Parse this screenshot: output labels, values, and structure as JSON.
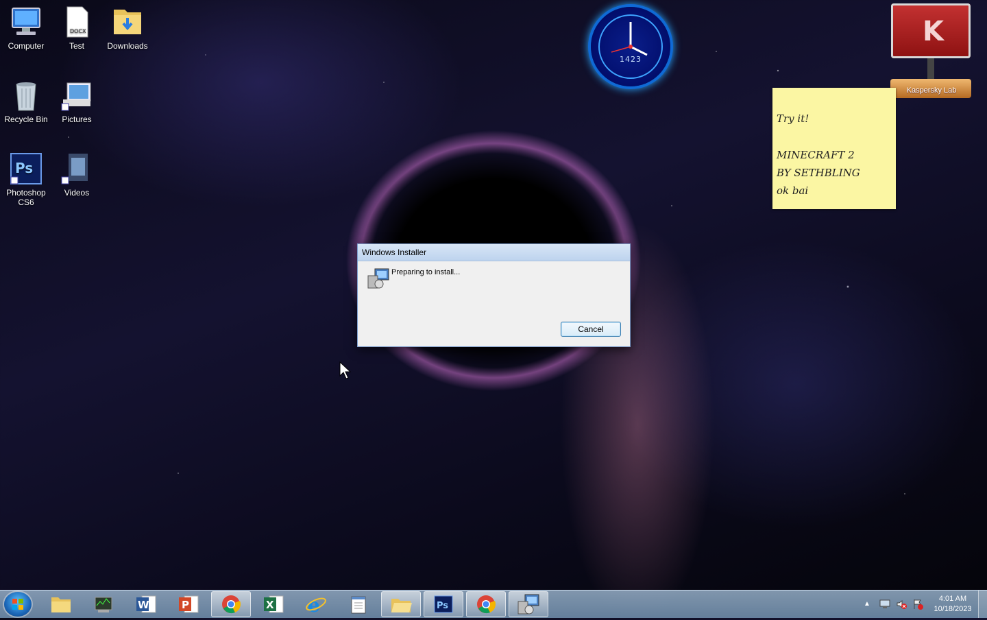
{
  "desktop": {
    "icons": [
      {
        "label": "Computer",
        "icon": "computer-icon"
      },
      {
        "label": "Test",
        "icon": "docx-file-icon",
        "badge": "DOCX"
      },
      {
        "label": "Downloads",
        "icon": "downloads-folder-icon"
      },
      {
        "label": "Recycle Bin",
        "icon": "recycle-bin-icon"
      },
      {
        "label": "Pictures",
        "icon": "pictures-shortcut-icon"
      },
      {
        "label": "Photoshop CS6",
        "icon": "photoshop-icon",
        "badge": "Ps"
      },
      {
        "label": "Videos",
        "icon": "videos-shortcut-icon"
      }
    ]
  },
  "clock_gadget": {
    "digits": "1423"
  },
  "kaspersky_gadget": {
    "label": "Kaspersky Lab"
  },
  "sticky_note": {
    "lines": [
      "Try it!",
      "MINECRAFT 2",
      "BY SETHBLING",
      "ok bai"
    ]
  },
  "dialog": {
    "title": "Windows Installer",
    "message": "Preparing to install...",
    "cancel_label": "Cancel"
  },
  "taskbar": {
    "items": [
      "start",
      "explorer",
      "task-manager",
      "word",
      "powerpoint",
      "chrome",
      "excel",
      "internet-explorer",
      "notepad",
      "folder",
      "photoshop",
      "chrome",
      "windows-installer"
    ],
    "tray": {
      "time": "4:01 AM",
      "date": "10/18/2023"
    }
  }
}
